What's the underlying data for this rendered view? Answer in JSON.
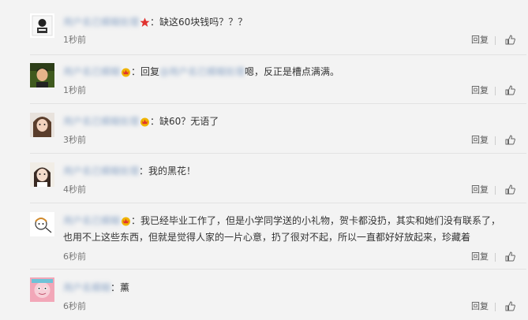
{
  "reply_label": "回复",
  "icons": {
    "like": "thumbs-up-icon",
    "badge_gold": "gold-crown-badge-icon",
    "badge_red": "red-star-badge-icon"
  },
  "colors": {
    "background": "#f3f3f3",
    "username": "#6b8db9",
    "text": "#333333",
    "badge_gold": "#f0b400",
    "badge_red": "#e0322f"
  },
  "comments": [
    {
      "username": "用户名已模糊处理",
      "badge": "red",
      "text": "：缺这60块钱吗？？？",
      "time": "1秒前"
    },
    {
      "username": "用户名已模糊",
      "badge": "gold",
      "prefix": "：回复",
      "mention": "@用户名已模糊处理",
      "text": "嗯，反正是槽点满满。",
      "time": "1秒前"
    },
    {
      "username": "用户名已模糊处理",
      "badge": "gold",
      "text": "：缺60？无语了",
      "time": "3秒前"
    },
    {
      "username": "用户名已模糊处理",
      "badge": "",
      "text": "：我的黑花！",
      "time": "4秒前"
    },
    {
      "username": "用户名已模糊",
      "badge": "gold",
      "text": "：我已经毕业工作了，但是小学同学送的小礼物，贺卡都没扔，其实和她们没有联系了，",
      "text2": "也用不上这些东西，但就是觉得人家的一片心意，扔了很对不起，所以一直都好好放起来，珍藏着",
      "time": "6秒前"
    },
    {
      "username": "用户名模糊",
      "badge": "",
      "text": "：薰",
      "time": "6秒前"
    }
  ]
}
